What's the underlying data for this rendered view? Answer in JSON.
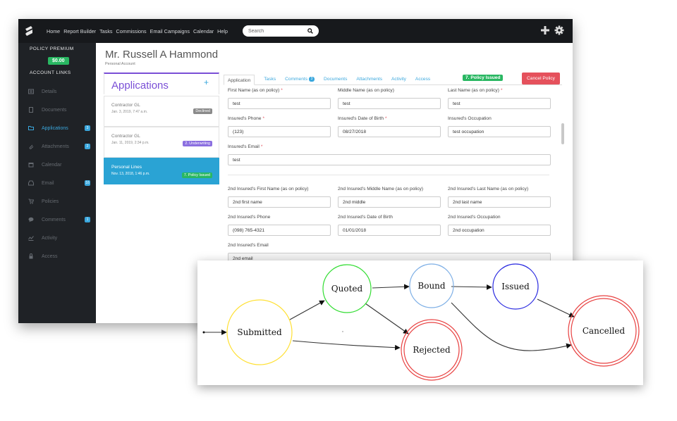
{
  "topbar": {
    "nav": [
      "Home",
      "Report Builder",
      "Tasks",
      "Commissions",
      "Email Campaigns",
      "Calendar",
      "Help"
    ],
    "search_placeholder": "Search",
    "icons": [
      "plus-icon",
      "gear-icon"
    ]
  },
  "sidebar": {
    "policy_premium_label": "POLICY PREMIUM",
    "premium_value": "$0.00",
    "account_links_label": "ACCOUNT LINKS",
    "items": [
      {
        "label": "Details",
        "icon": "details-icon",
        "badge": ""
      },
      {
        "label": "Documents",
        "icon": "document-icon",
        "badge": ""
      },
      {
        "label": "Applications",
        "icon": "folder-icon",
        "badge": "3"
      },
      {
        "label": "Attachments",
        "icon": "paperclip-icon",
        "badge": "2"
      },
      {
        "label": "Calendar",
        "icon": "calendar-icon",
        "badge": ""
      },
      {
        "label": "Email",
        "icon": "inbox-icon",
        "badge": "16"
      },
      {
        "label": "Policies",
        "icon": "cart-icon",
        "badge": ""
      },
      {
        "label": "Comments",
        "icon": "comment-icon",
        "badge": "1"
      },
      {
        "label": "Activity",
        "icon": "activity-icon",
        "badge": ""
      },
      {
        "label": "Access",
        "icon": "lock-icon",
        "badge": ""
      }
    ],
    "active_index": 2,
    "colors": {
      "active": "#3aa7dd",
      "premium": "#29b762"
    }
  },
  "customer": {
    "name": "Mr. Russell A Hammond",
    "type": "Personal Account"
  },
  "applications": {
    "title": "Applications",
    "add": "+",
    "cards": [
      {
        "title": "Contractor GL",
        "date": "Jan. 3, 2019, 7:47 a.m.",
        "status": "Declined",
        "status_color": "#8a8a8a"
      },
      {
        "title": "Contractor GL",
        "date": "Jan. 11, 2019, 2:34 p.m.",
        "status": "2. Underwriting",
        "status_color": "#8b6fe0"
      },
      {
        "title": "Personal Lines",
        "date": "Nov. 13, 2018, 1:46 p.m.",
        "status": "7. Policy Issued",
        "status_color": "#29b762"
      }
    ],
    "selected_index": 2
  },
  "tabs": {
    "items": [
      "Application",
      "Tasks",
      "Comments",
      "Documents",
      "Attachments",
      "Activity",
      "Access"
    ],
    "comments_badge": "3",
    "active": "Application",
    "status": "7. Policy Issued",
    "cancel_label": "Cancel Policy"
  },
  "form": {
    "fields": [
      {
        "label": "First Name (as on policy)",
        "required": true,
        "value": "test"
      },
      {
        "label": "Middle Name (as on policy)",
        "required": false,
        "value": "test"
      },
      {
        "label": "Last Name (as on policy)",
        "required": true,
        "value": "test"
      },
      {
        "label": "Insured's Phone",
        "required": true,
        "value": "(123)"
      },
      {
        "label": "Insured's Date of Birth",
        "required": true,
        "value": "08/27/2018"
      },
      {
        "label": "Insured's Occupation",
        "required": false,
        "value": "test occupation"
      },
      {
        "label": "Insured's Email",
        "required": true,
        "value": "test"
      },
      {
        "label": "2nd Insured's First Name (as on policy)",
        "required": false,
        "value": "2nd first name"
      },
      {
        "label": "2nd Insured's Middle Name (as on policy)",
        "required": false,
        "value": "2nd middle"
      },
      {
        "label": "2nd Insured's Last Name (as on policy)",
        "required": false,
        "value": "2nd last name"
      },
      {
        "label": "2nd Insured's Phone",
        "required": false,
        "value": "(098) 765-4321"
      },
      {
        "label": "2nd Insured's Date of Birth",
        "required": false,
        "value": "01/01/2018"
      },
      {
        "label": "2nd Insured's Occupation",
        "required": false,
        "value": "2nd occupation"
      },
      {
        "label": "2nd Insured's Email",
        "required": false,
        "value": "2nd email"
      }
    ]
  },
  "diagram": {
    "states": [
      {
        "id": "submitted",
        "label": "Submitted",
        "color": "#ffe033",
        "double": false
      },
      {
        "id": "quoted",
        "label": "Quoted",
        "color": "#33dd33",
        "double": false
      },
      {
        "id": "bound",
        "label": "Bound",
        "color": "#7fb0e6",
        "double": false
      },
      {
        "id": "issued",
        "label": "Issued",
        "color": "#2a2ae0",
        "double": false
      },
      {
        "id": "rejected",
        "label": "Rejected",
        "color": "#e84040",
        "double": true
      },
      {
        "id": "cancelled",
        "label": "Cancelled",
        "color": "#e84040",
        "double": true
      }
    ],
    "transitions": [
      [
        "start",
        "submitted"
      ],
      [
        "submitted",
        "quoted"
      ],
      [
        "submitted",
        "rejected"
      ],
      [
        "quoted",
        "bound"
      ],
      [
        "quoted",
        "rejected"
      ],
      [
        "bound",
        "issued"
      ],
      [
        "bound",
        "cancelled"
      ],
      [
        "issued",
        "cancelled"
      ]
    ]
  }
}
